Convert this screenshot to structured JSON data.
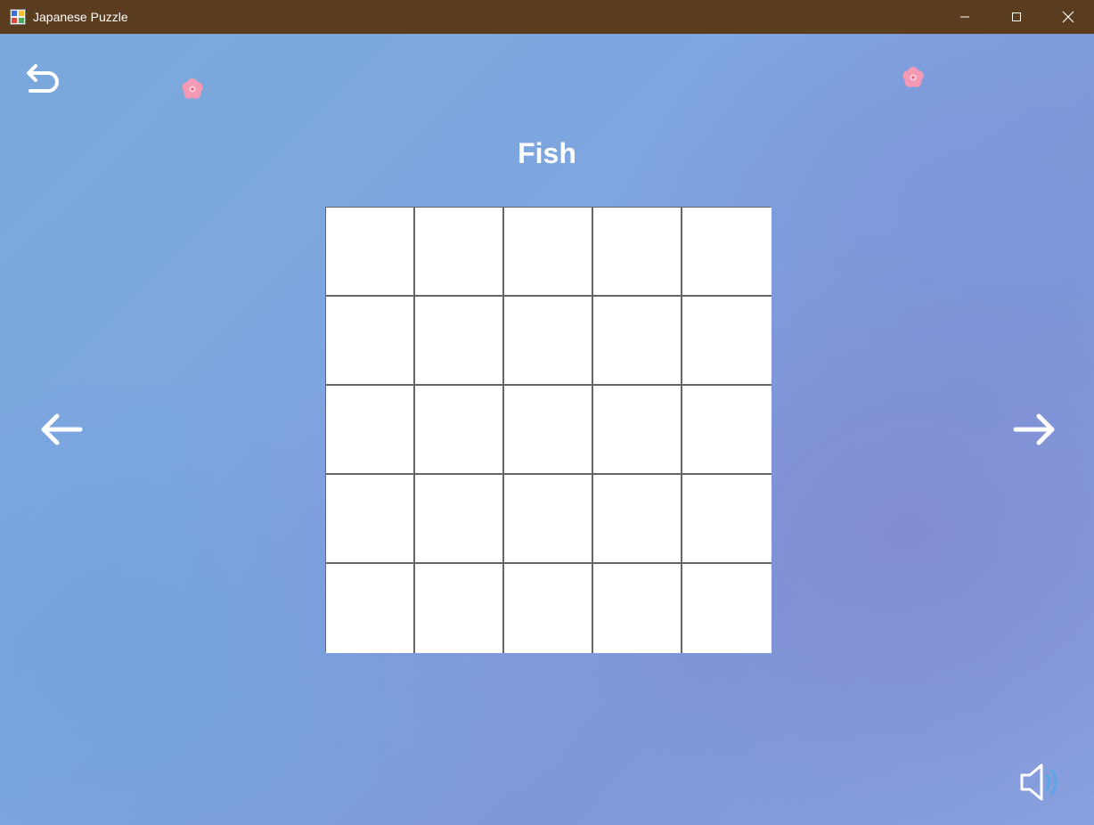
{
  "window": {
    "title": "Japanese Puzzle",
    "icon": "app-icon",
    "controls": [
      "minimize-icon",
      "maximize-icon",
      "close-icon"
    ],
    "titlebar_color": "#5a3c1f"
  },
  "toolbar": {
    "back_icon": "undo-arrow-icon",
    "sound_icon": "speaker-icon"
  },
  "decorations": [
    "cherry-blossom-icon",
    "cherry-blossom-icon"
  ],
  "puzzle": {
    "title": "Fish",
    "rows": 5,
    "columns": 5,
    "cells": [
      [
        0,
        0,
        0,
        0,
        0
      ],
      [
        0,
        0,
        0,
        0,
        0
      ],
      [
        0,
        0,
        0,
        0,
        0
      ],
      [
        0,
        0,
        0,
        0,
        0
      ],
      [
        0,
        0,
        0,
        0,
        0
      ]
    ]
  },
  "navigation": {
    "previous_icon": "arrow-left-icon",
    "next_icon": "arrow-right-icon"
  },
  "colors": {
    "background": "#7fa6de",
    "grid_line": "#666666",
    "cell_empty": "#ffffff",
    "text": "#ffffff",
    "flower": "#f49ab4"
  }
}
